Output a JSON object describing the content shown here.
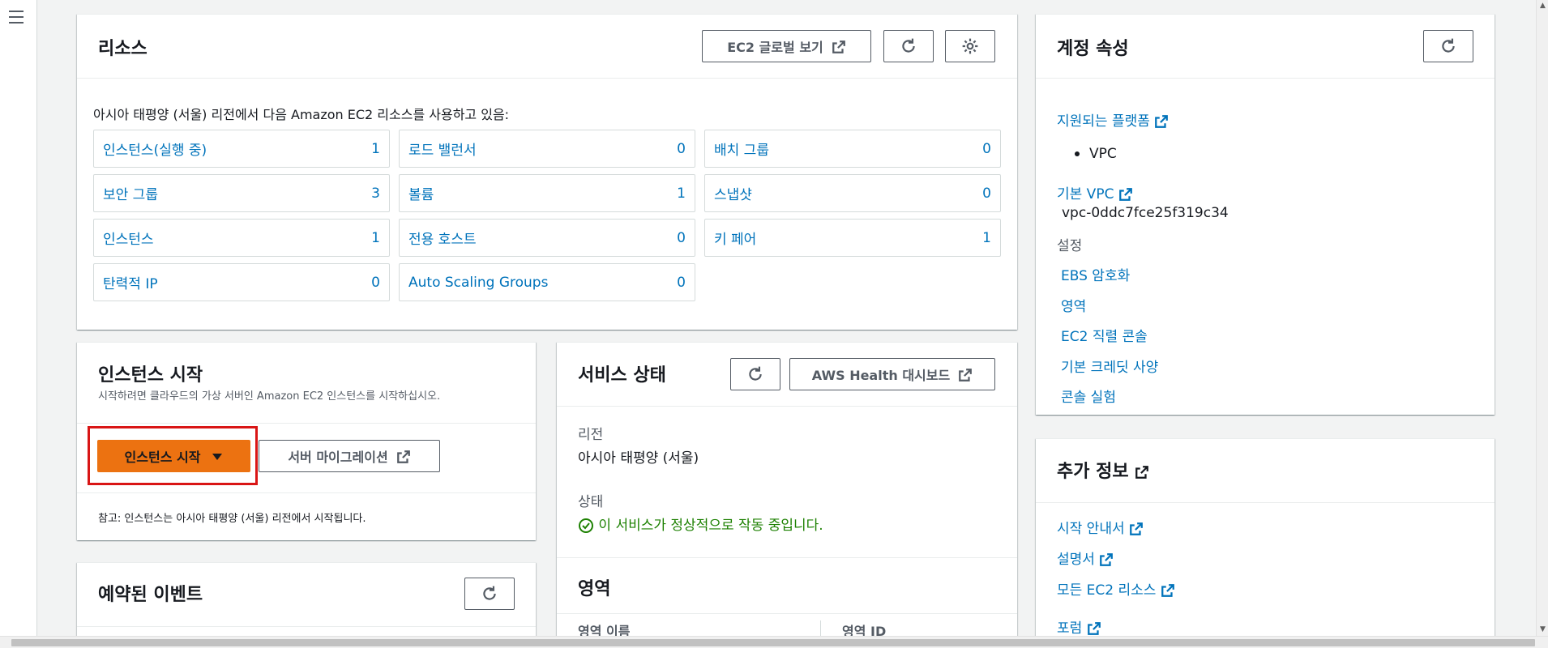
{
  "resources": {
    "title": "리소스",
    "global_view_label": "EC2 글로벌 보기",
    "intro": "아시아 태평양 (서울) 리전에서 다음 Amazon EC2 리소스를 사용하고 있음:",
    "items": [
      {
        "name": "인스턴스(실행 중)",
        "count": "1"
      },
      {
        "name": "로드 밸런서",
        "count": "0"
      },
      {
        "name": "배치 그룹",
        "count": "0"
      },
      {
        "name": "보안 그룹",
        "count": "3"
      },
      {
        "name": "볼륨",
        "count": "1"
      },
      {
        "name": "스냅샷",
        "count": "0"
      },
      {
        "name": "인스턴스",
        "count": "1"
      },
      {
        "name": "전용 호스트",
        "count": "0"
      },
      {
        "name": "키 페어",
        "count": "1"
      },
      {
        "name": "탄력적 IP",
        "count": "0"
      },
      {
        "name": "Auto Scaling Groups",
        "count": "0"
      }
    ]
  },
  "account": {
    "title": "계정 속성",
    "supported_platforms": "지원되는 플랫폼",
    "platform_item": "VPC",
    "default_vpc": "기본 VPC",
    "vpc_id": "vpc-0ddc7fce25f319c34",
    "settings_label": "설정",
    "settings": [
      "EBS 암호화",
      "영역",
      "EC2 직렬 콘솔",
      "기본 크레딧 사양",
      "콘솔 실험"
    ]
  },
  "launch": {
    "title": "인스턴스 시작",
    "subtitle": "시작하려면 클라우드의 가상 서버인 Amazon EC2 인스턴스를 시작하십시오.",
    "primary_label": "인스턴스 시작",
    "migration_label": "서버 마이그레이션",
    "note": "참고: 인스턴스는 아시아 태평양 (서울) 리전에서 시작됩니다."
  },
  "service_health": {
    "title": "서비스 상태",
    "dashboard_label": "AWS Health 대시보드",
    "region_label": "리전",
    "region_value": "아시아 태평양 (서울)",
    "status_label": "상태",
    "status_value": "이 서비스가 정상적으로 작동 중입니다.",
    "zones_title": "영역",
    "zone_col1": "영역 이름",
    "zone_col2": "영역 ID"
  },
  "scheduled_events": {
    "title": "예약된 이벤트"
  },
  "more_info": {
    "title": "추가 정보",
    "links": [
      "시작 안내서",
      "설명서",
      "모든 EC2 리소스",
      "포럼"
    ]
  },
  "colors": {
    "link": "#0073bb",
    "primary": "#ec7211",
    "success": "#1d8102",
    "highlight": "#d91515"
  }
}
